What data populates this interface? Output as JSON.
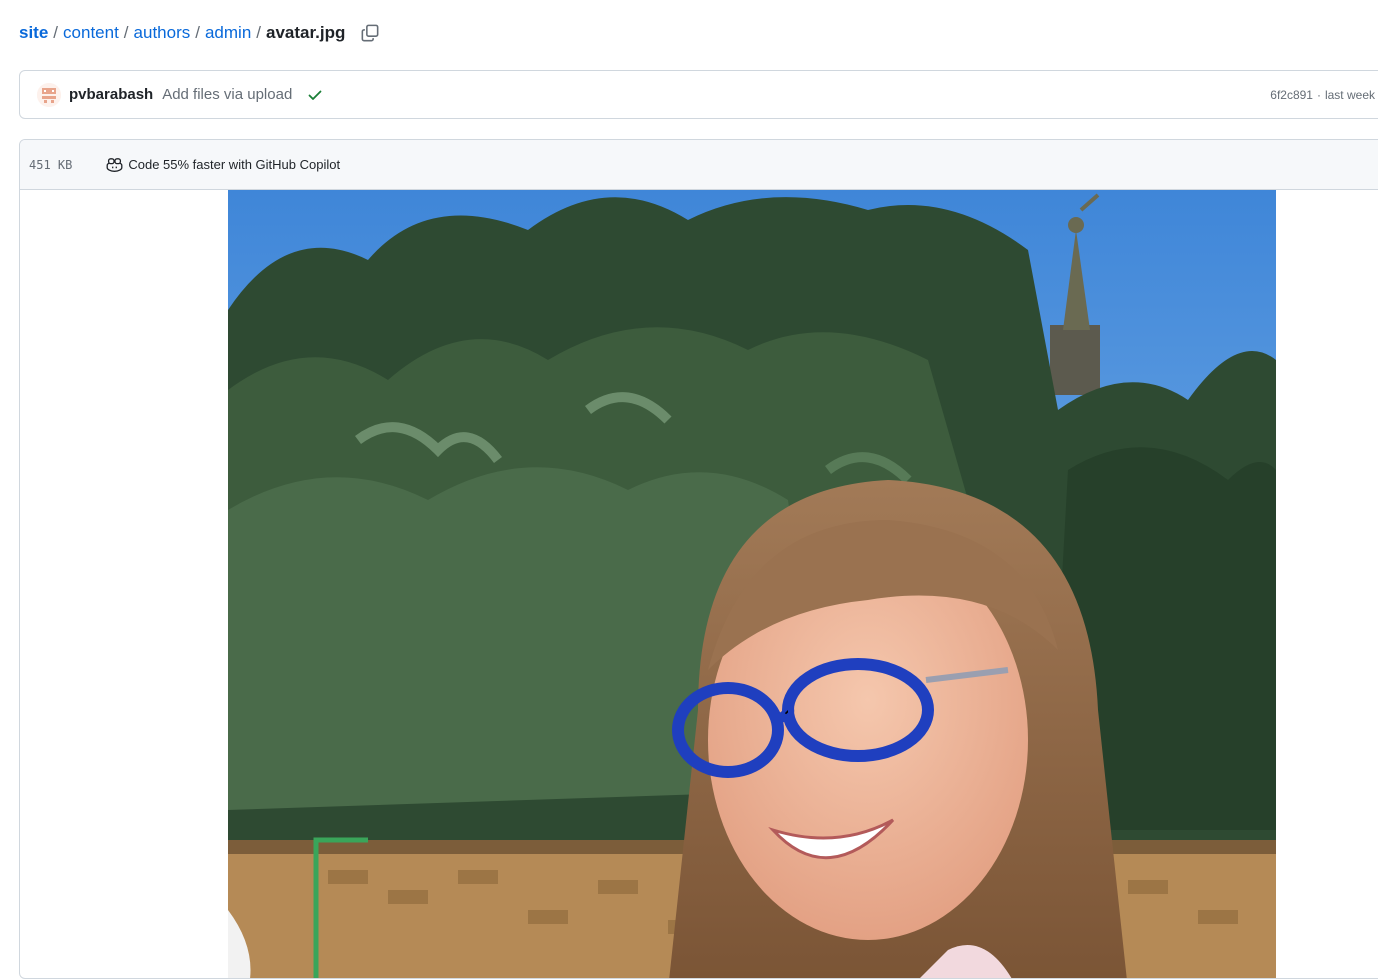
{
  "breadcrumb": {
    "root": "site",
    "parts": [
      "content",
      "authors",
      "admin"
    ],
    "separator": "/",
    "current": "avatar.jpg",
    "copy_icon": "copy-icon"
  },
  "commit": {
    "author": "pvbarabash",
    "message": "Add files via upload",
    "status_icon": "check-icon",
    "sha": "6f2c891",
    "separator": "·",
    "time": "last week"
  },
  "file": {
    "size": "451 KB",
    "copilot_icon": "copilot-icon",
    "copilot_text": "Code 55% faster with GitHub Copilot"
  },
  "colors": {
    "link": "#0969da",
    "text": "#1f2328",
    "muted": "#656d76",
    "border": "#d0d7de",
    "header_bg": "#f6f8fa",
    "success": "#1a7f37"
  }
}
